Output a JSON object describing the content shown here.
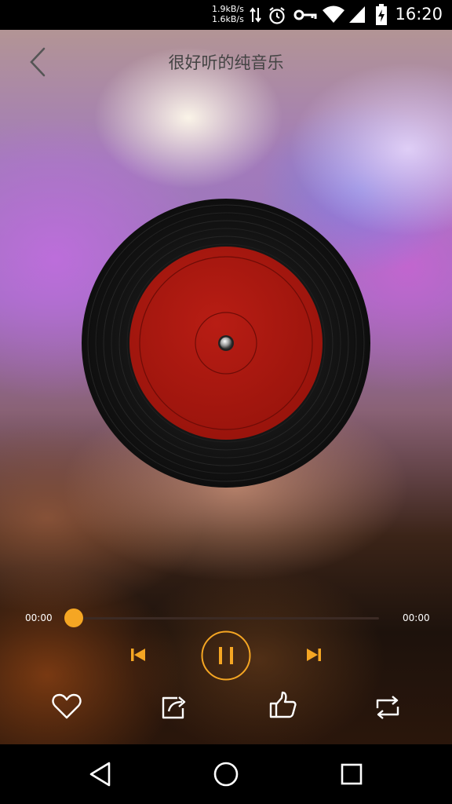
{
  "status_bar": {
    "net_up": "1.9kB/s",
    "net_down": "1.6kB/s",
    "time": "16:20",
    "icons": [
      "data-transfer-icon",
      "alarm-icon",
      "vpn-key-icon",
      "wifi-icon",
      "signal-icon",
      "battery-charging-icon"
    ]
  },
  "header": {
    "title": "很好听的纯音乐",
    "back_icon": "chevron-left-icon"
  },
  "player": {
    "artwork": "vinyl-record",
    "current_time": "00:00",
    "total_time": "00:00",
    "progress": 0,
    "state": "playing",
    "controls": [
      "skip-previous-icon",
      "pause-icon",
      "skip-next-icon"
    ],
    "actions": [
      "heart-icon",
      "share-icon",
      "thumbs-up-icon",
      "repeat-icon"
    ]
  },
  "nav_bar": {
    "icons": [
      "back-triangle-icon",
      "home-circle-icon",
      "recents-square-icon"
    ]
  },
  "colors": {
    "accent": "#f5a623",
    "label_red": "#a8180f",
    "vinyl_black": "#151515"
  }
}
